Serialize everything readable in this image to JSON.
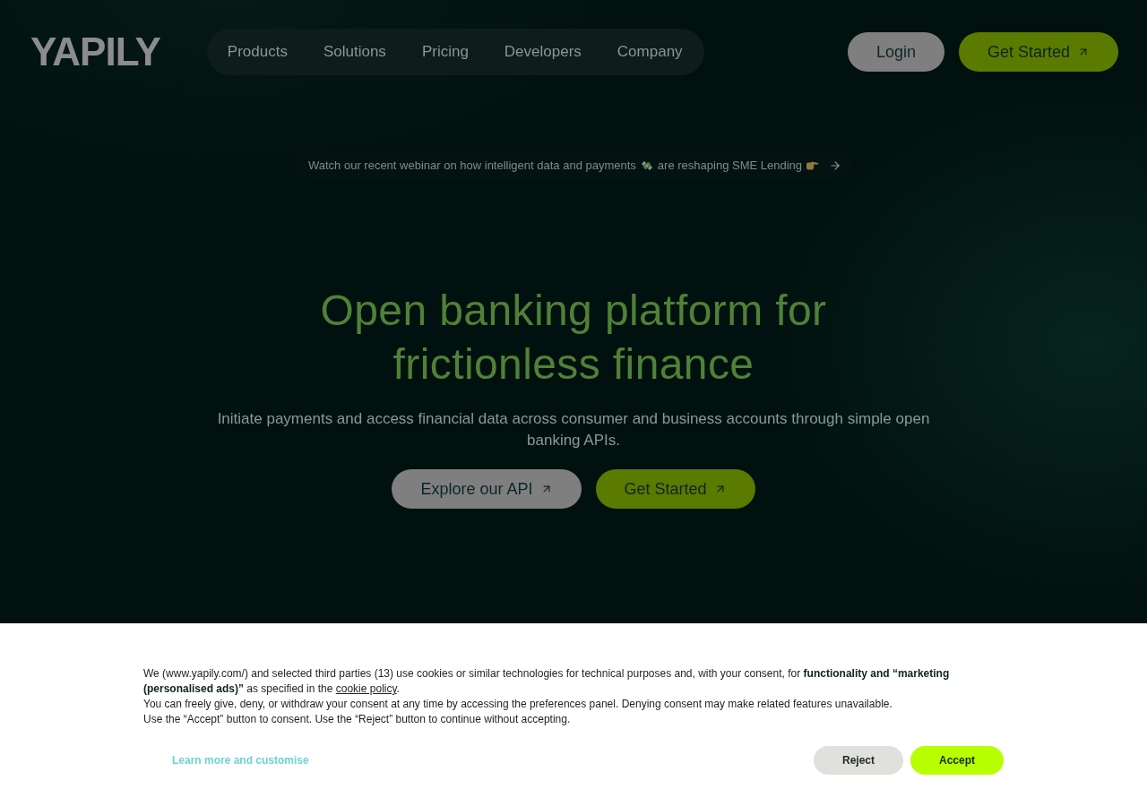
{
  "logo": "YAPILY",
  "nav": {
    "items": [
      "Products",
      "Solutions",
      "Pricing",
      "Developers",
      "Company"
    ]
  },
  "header_actions": [
    {
      "label": "Login",
      "kind": "secondary",
      "arrow": false
    },
    {
      "label": "Get Started",
      "kind": "primary",
      "arrow": true
    }
  ],
  "announcement": {
    "text_before": "Watch our recent webinar on how intelligent data and payments",
    "text_after": "are reshaping SME Lending"
  },
  "hero": {
    "title_lines": [
      "Open banking platform for",
      "frictionless finance"
    ],
    "subtitle": "Initiate payments and access financial data across consumer and business accounts through simple open banking APIs.",
    "buttons": [
      {
        "label": "Explore our API",
        "kind": "secondary",
        "arrow": true
      },
      {
        "label": "Get Started",
        "kind": "primary",
        "arrow": true
      }
    ]
  },
  "cookie_banner": {
    "notice": {
      "text": "We (www.yapily.com/) and selected third parties (13) use cookies or similar technologies for technical purposes and, with your consent, for **functionality and “marketing (personalised ads)”** as specified in the ",
      "link": "cookie policy",
      "end": "."
    },
    "lines": [
      "You can freely give, deny, or withdraw your consent at any time by accessing the preferences panel. Denying consent may make related features unavailable.",
      "Use the “Accept” button to consent. Use the “Reject” button to continue without accepting."
    ],
    "customise_link": "Learn more and customise",
    "buttons": [
      {
        "label": "Reject",
        "kind": "reject"
      },
      {
        "label": "Accept",
        "kind": "accept"
      }
    ]
  }
}
